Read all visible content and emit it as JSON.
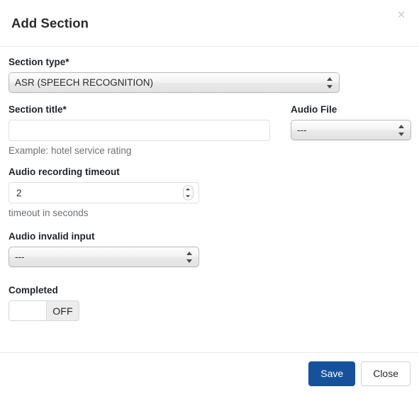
{
  "modal": {
    "title": "Add Section",
    "close_icon": "close-icon",
    "close_label": "×"
  },
  "form": {
    "section_type": {
      "label": "Section type*",
      "value": "ASR (SPEECH RECOGNITION)",
      "options": [
        "ASR (SPEECH RECOGNITION)"
      ]
    },
    "section_title": {
      "label": "Section title*",
      "value": "",
      "placeholder": "",
      "help": "Example: hotel service rating"
    },
    "audio_file": {
      "label": "Audio File",
      "value": "---",
      "options": [
        "---"
      ]
    },
    "audio_recording_timeout": {
      "label": "Audio recording timeout",
      "value": "2",
      "help": "timeout in seconds"
    },
    "audio_invalid_input": {
      "label": "Audio invalid input",
      "value": "---",
      "options": [
        "---"
      ]
    },
    "completed": {
      "label": "Completed",
      "state": "OFF"
    }
  },
  "footer": {
    "save_label": "Save",
    "close_label": "Close"
  },
  "colors": {
    "primary": "#16529c",
    "border": "#e9ecef",
    "help_text": "#6f7276",
    "toggle_off_bg": "#ececec"
  }
}
